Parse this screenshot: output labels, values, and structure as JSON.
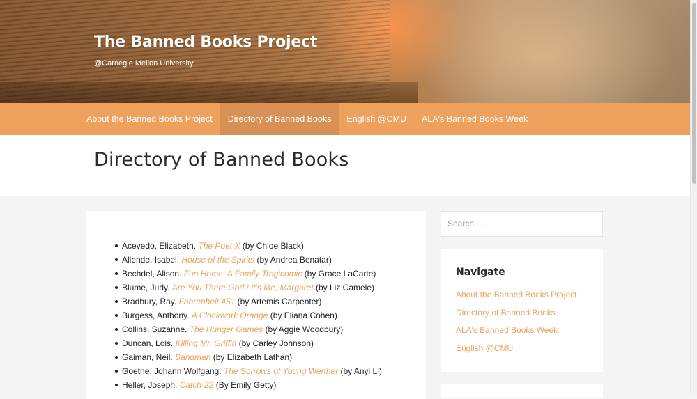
{
  "site": {
    "title": "The Banned Books Project",
    "subtitle": "@Carnegie Mellon University"
  },
  "nav": {
    "items": [
      {
        "label": "About the Banned Books Project",
        "active": false
      },
      {
        "label": "Directory of Banned Books",
        "active": true
      },
      {
        "label": "English @CMU",
        "active": false
      },
      {
        "label": "ALA's Banned Books Week",
        "active": false
      }
    ]
  },
  "page": {
    "title": "Directory of Banned Books"
  },
  "directory": {
    "entries": [
      {
        "author": "Acevedo, Elizabeth, ",
        "book": "The Poet X",
        "by": " (by Chloe Black)"
      },
      {
        "author": "Allende, Isabel. ",
        "book": "House of the Spirits",
        "by": " (by Andrea Benatar)"
      },
      {
        "author": "Bechdel, Alison. ",
        "book": "Fun Home: A Family Tragicomic",
        "by": " (by Grace LaCarte)"
      },
      {
        "author": "Blume, Judy. ",
        "book": "Are You There God? It's Me, Margaret",
        "by": " (by Liz Camele)"
      },
      {
        "author": "Bradbury, Ray. ",
        "book": "Fahrenheit 451",
        "by": " (by Artemis Carpenter)"
      },
      {
        "author": "Burgess, Anthony. ",
        "book": "A Clockwork Orange",
        "by": " (by Eliana Cohen)"
      },
      {
        "author": "Collins, Suzanne. ",
        "book": "The Hunger Games",
        "by": " (by Aggie Woodbury)"
      },
      {
        "author": "Duncan, Lois. ",
        "book": "Killing Mr. Griffin",
        "by": " (by Carley Johnson)"
      },
      {
        "author": "Gaiman, Neil. ",
        "book": "Sandman",
        "by": " (by Elizabeth Lathan)"
      },
      {
        "author": "Goethe, Johann Wolfgang. ",
        "book": "The Sorrows of Young Werther",
        "by": " (by Anyi Li)"
      },
      {
        "author": "Heller, Joseph. ",
        "book": "Catch-22",
        "by": " (By Emily Getty)"
      }
    ]
  },
  "sidebar": {
    "search_placeholder": "Search …",
    "navigate": {
      "heading": "Navigate",
      "links": [
        "About the Banned Books Project",
        "Directory of Banned Books",
        "ALA's Banned Books Week",
        "English @CMU"
      ]
    }
  },
  "colors": {
    "accent": "#eda15c",
    "nav_active": "#d99054",
    "text": "#222222"
  }
}
